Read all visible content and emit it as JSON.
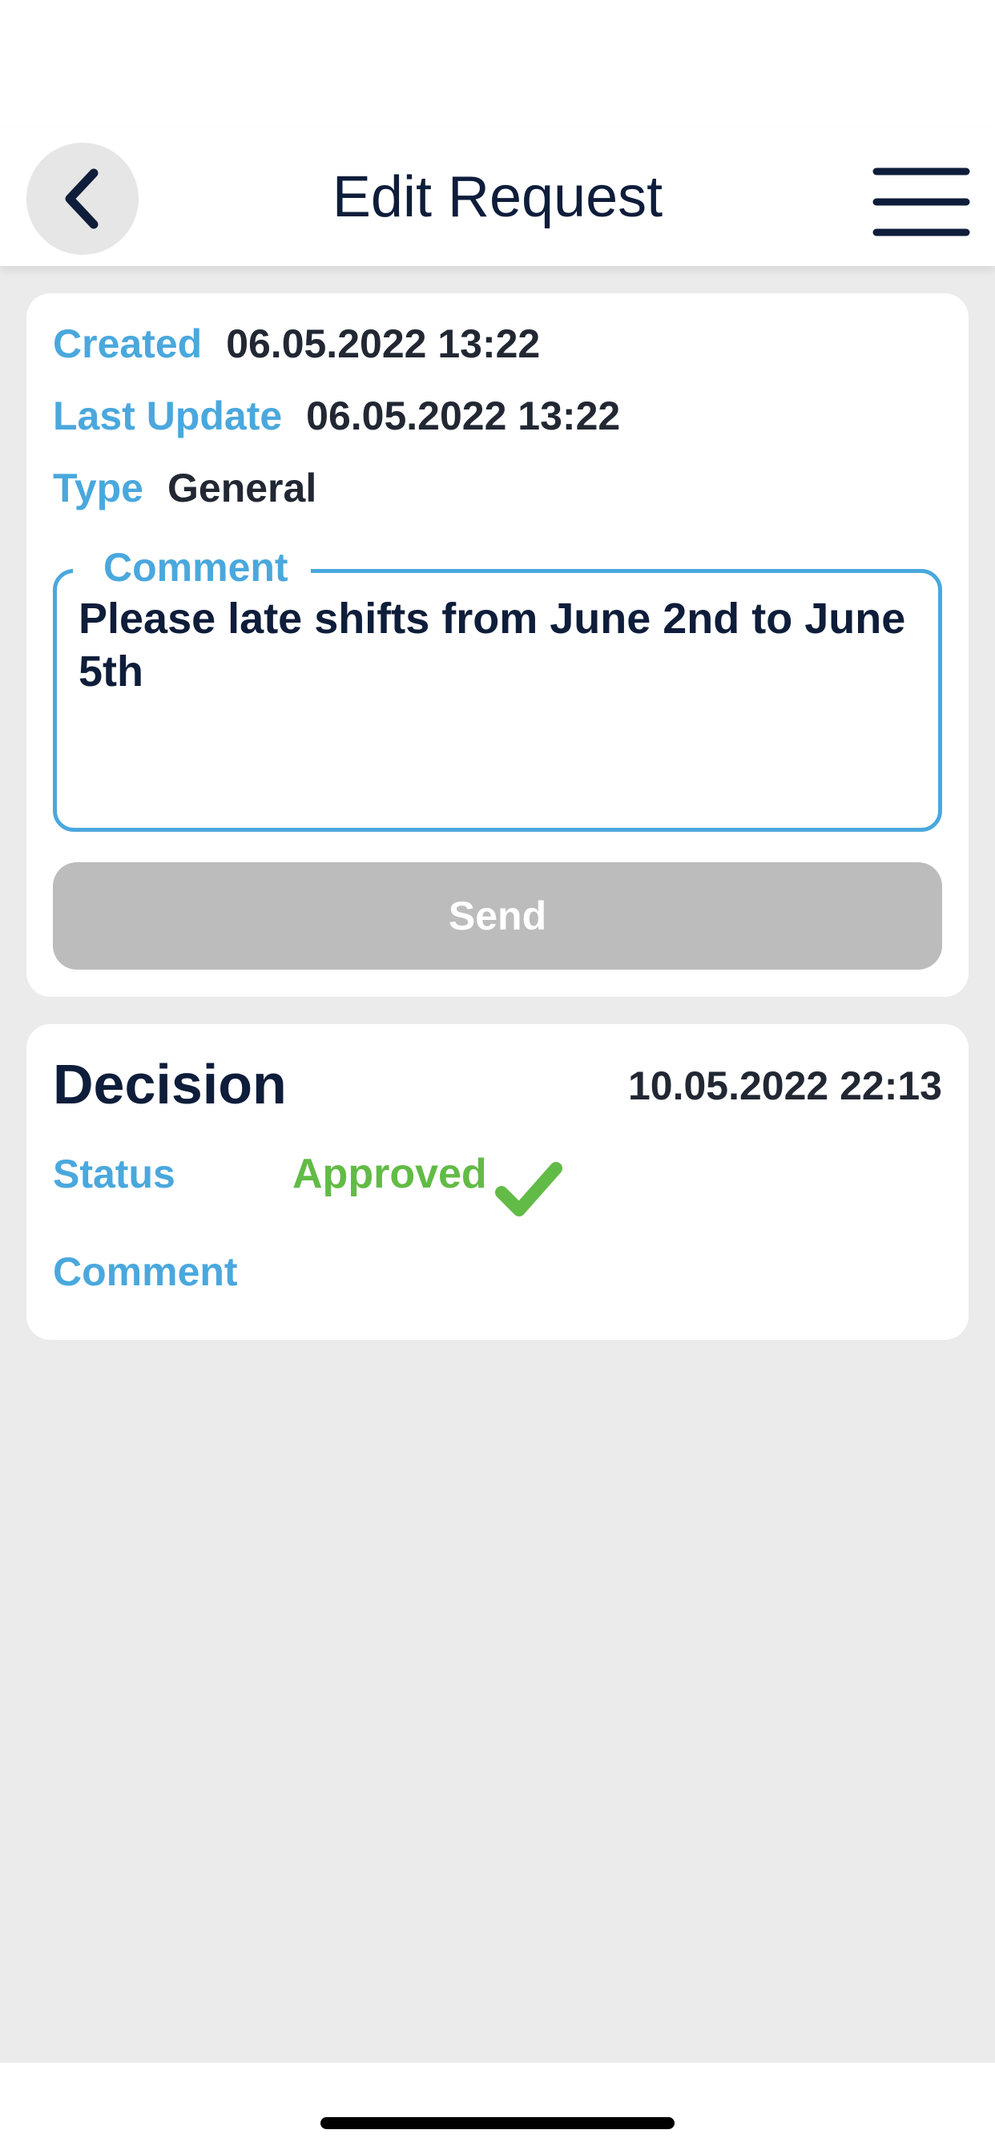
{
  "header": {
    "title": "Edit Request",
    "back_icon": "chevron-left-icon",
    "menu_icon": "hamburger-menu-icon"
  },
  "request": {
    "created_label": "Created",
    "created_value": "06.05.2022 13:22",
    "updated_label": "Last Update",
    "updated_value": "06.05.2022 13:22",
    "type_label": "Type",
    "type_value": "General",
    "comment_label": "Comment",
    "comment_value": "Please late shifts from June 2nd to June 5th",
    "send_label": "Send"
  },
  "decision": {
    "title": "Decision",
    "date": "10.05.2022 22:13",
    "status_label": "Status",
    "status_value": "Approved",
    "status_icon": "checkmark-icon",
    "comment_label": "Comment"
  },
  "colors": {
    "accent": "#4aa8dd",
    "navy": "#0e1d3a",
    "approved": "#62bb46",
    "disabled_button": "#bcbcbc",
    "background": "#ebebeb"
  }
}
